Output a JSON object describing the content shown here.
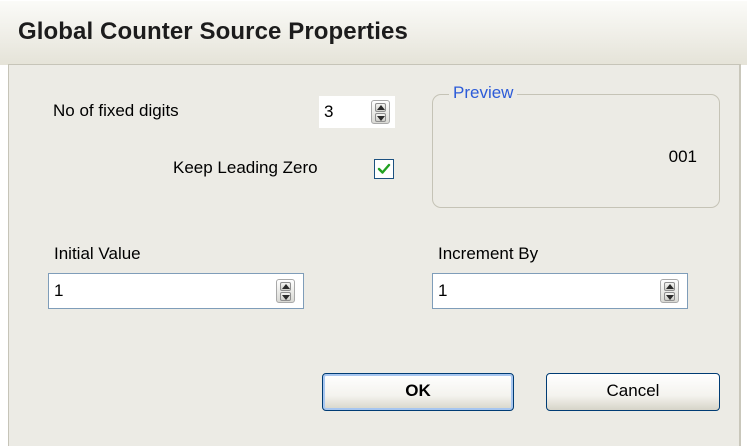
{
  "dialog": {
    "title": "Global Counter Source Properties"
  },
  "fixed_digits": {
    "label": "No of fixed digits",
    "value": "3"
  },
  "keep_leading_zero": {
    "label": "Keep Leading Zero",
    "checked": true
  },
  "preview": {
    "title": "Preview",
    "value": "001"
  },
  "initial_value": {
    "label": "Initial Value",
    "value": "1"
  },
  "increment_by": {
    "label": "Increment By",
    "value": "1"
  },
  "buttons": {
    "ok": "OK",
    "cancel": "Cancel"
  },
  "colors": {
    "group_title": "#2c5bd8",
    "check_mark": "#21a121",
    "button_border": "#003c74"
  }
}
